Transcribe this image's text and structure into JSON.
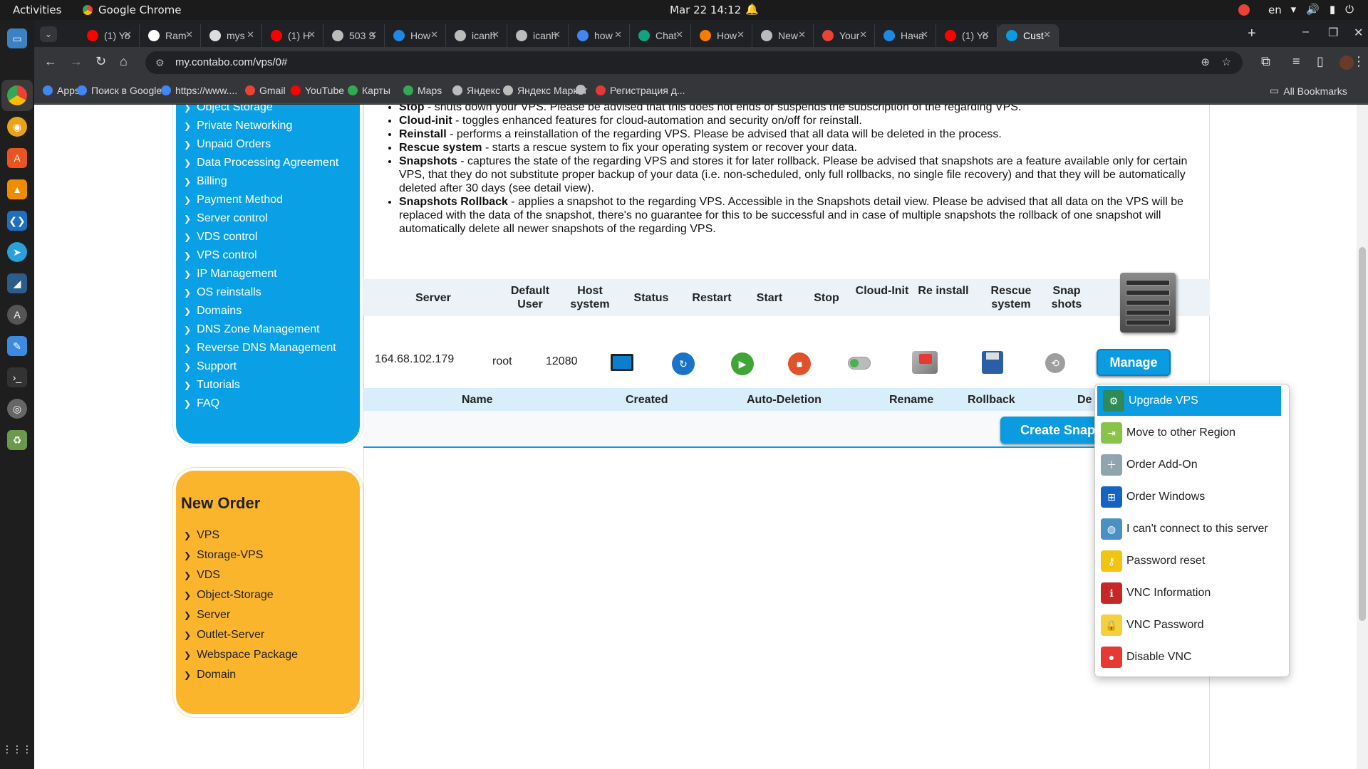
{
  "topbar": {
    "activities": "Activities",
    "app": "Google Chrome",
    "clock": "Mar 22  14:12",
    "lang": "en"
  },
  "tabs": [
    {
      "label": "(1) Yo",
      "color": "#ff0000"
    },
    {
      "label": "Ram",
      "color": "#ffffff"
    },
    {
      "label": "mys",
      "color": "#dddddd"
    },
    {
      "label": "(1) H",
      "color": "#ff0000"
    },
    {
      "label": "503 S",
      "color": "#bbbbbb"
    },
    {
      "label": "How",
      "color": "#1e88e5"
    },
    {
      "label": "icanh",
      "color": "#bbbbbb"
    },
    {
      "label": "icanh",
      "color": "#bbbbbb"
    },
    {
      "label": "how",
      "color": "#4285f4"
    },
    {
      "label": "Chat",
      "color": "#10a37f"
    },
    {
      "label": "How",
      "color": "#f57c00"
    },
    {
      "label": "New",
      "color": "#bbbbbb"
    },
    {
      "label": "Your",
      "color": "#ea4335"
    },
    {
      "label": "Нача",
      "color": "#1e88e5"
    },
    {
      "label": "(1) Yo",
      "color": "#ff0000"
    },
    {
      "label": "Cust",
      "color": "#0a9be0",
      "active": true
    }
  ],
  "omnibox": {
    "url": "my.contabo.com/vps/0#"
  },
  "bookmarks": [
    {
      "label": "Apps",
      "color": "#4285f4"
    },
    {
      "label": "Поиск в Google",
      "color": "#4285f4"
    },
    {
      "label": "https://www....",
      "color": "#4285f4"
    },
    {
      "label": "Gmail",
      "color": "#ea4335"
    },
    {
      "label": "YouTube",
      "color": "#ff0000"
    },
    {
      "label": "Карты",
      "color": "#34a853"
    },
    {
      "label": "Maps",
      "color": "#34a853"
    },
    {
      "label": "Яндекс",
      "color": "#bbbbbb"
    },
    {
      "label": "Яндекс Маркет",
      "color": "#bbbbbb"
    },
    {
      "label": "",
      "color": "#bbbbbb"
    },
    {
      "label": "Регистрация д...",
      "color": "#e53935"
    }
  ],
  "all_bookmarks": "All Bookmarks",
  "sidebar": {
    "items": [
      "Object Storage",
      "Private Networking",
      "Unpaid Orders",
      "Data Processing Agreement",
      "Billing",
      "Payment Method",
      "Server control",
      "VDS control",
      "VPS control",
      "IP Management",
      "OS reinstalls",
      "Domains",
      "DNS Zone Management",
      "Reverse DNS Management",
      "Support",
      "Tutorials",
      "FAQ"
    ]
  },
  "new_order": {
    "title": "New Order",
    "items": [
      "VPS",
      "Storage-VPS",
      "VDS",
      "Object-Storage",
      "Server",
      "Outlet-Server",
      "Webspace Package",
      "Domain"
    ]
  },
  "description": [
    {
      "term": "Stop",
      "text": " - shuts down your VPS. Please be advised that this does not ends or suspends the subscription of the regarding VPS."
    },
    {
      "term": "Cloud-init",
      "text": " - toggles enhanced features for cloud-automation and security on/off for reinstall."
    },
    {
      "term": "Reinstall",
      "text": " - performs a reinstallation of the regarding VPS. Please be advised that all data will be deleted in the process."
    },
    {
      "term": "Rescue system",
      "text": " - starts a rescue system to fix your operating system or recover your data."
    },
    {
      "term": "Snapshots",
      "text": " - captures the state of the regarding VPS and stores it for later rollback. Please be advised that snapshots are a feature available only for certain VPS, that they do not substitute proper backup of your data (i.e. non-scheduled, only full rollbacks, no single file recovery) and that they will be automatically deleted after 30 days (see detail view)."
    },
    {
      "term": "Snapshots Rollback",
      "text": " - applies a snapshot to the regarding VPS. Accessible in the Snapshots detail view. Please be advised that all data on the VPS will be replaced with the data of the snapshot, there's no guarantee for this to be successful and in case of multiple snapshots the rollback of one snapshot will automatically delete all newer snapshots of the regarding VPS."
    }
  ],
  "table": {
    "headers": [
      "Server",
      "Default User",
      "Host system",
      "Status",
      "Restart",
      "Start",
      "Stop",
      "Cloud-Init",
      "Re install",
      "Rescue system",
      "Snap shots"
    ],
    "row": {
      "server": "164.68.102.179",
      "user": "root",
      "host": "12080"
    },
    "manage": "Manage"
  },
  "snapshots": {
    "headers": [
      "Name",
      "Created",
      "Auto-Deletion",
      "Rename",
      "Rollback",
      "De"
    ],
    "create": "Create Snap"
  },
  "menu": [
    {
      "label": "Upgrade VPS",
      "icon": "gear-upgrade-icon",
      "color": "#2e8b57",
      "highlighted": true
    },
    {
      "label": "Move to other Region",
      "icon": "move-region-icon",
      "color": "#8bc34a"
    },
    {
      "label": "Order Add-On",
      "icon": "addon-icon",
      "color": "#90a4ae"
    },
    {
      "label": "Order Windows",
      "icon": "windows-icon",
      "color": "#1565c0"
    },
    {
      "label": "I can't connect to this server",
      "icon": "globe-icon",
      "color": "#4a90c2"
    },
    {
      "label": "Password reset",
      "icon": "key-icon",
      "color": "#f1c40f"
    },
    {
      "label": "VNC Information",
      "icon": "vnc-info-icon",
      "color": "#c62828"
    },
    {
      "label": "VNC Password",
      "icon": "padlock-icon",
      "color": "#f4d03f"
    },
    {
      "label": "Disable VNC",
      "icon": "toggle-off-icon",
      "color": "#e53935"
    }
  ]
}
